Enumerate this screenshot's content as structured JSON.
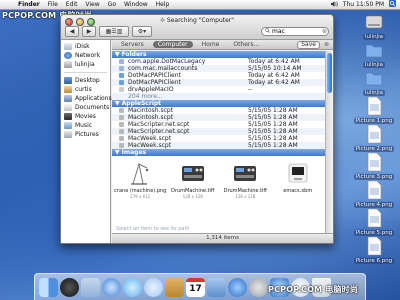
{
  "menubar": {
    "items": [
      "Finder",
      "File",
      "Edit",
      "View",
      "Go",
      "Window",
      "Help"
    ],
    "clock": "Thu 11:50 PM"
  },
  "watermarks": {
    "top_left": "PCPOP.COM 电脑时尚",
    "bottom_right": "PCPOP.COM 电脑时尚"
  },
  "window": {
    "title": "Searching \"Computer\"",
    "search_value": "mac",
    "search_placeholder": "Search",
    "scopes": [
      "Servers",
      "Computer",
      "Home",
      "Others..."
    ],
    "active_scope": "Computer",
    "save_label": "Save",
    "sidebar": {
      "places": [
        {
          "label": "iDisk",
          "icon": "idisk-icon"
        },
        {
          "label": "Network",
          "icon": "network-icon"
        },
        {
          "label": "lulinjia",
          "icon": "drive-icon"
        }
      ],
      "folders": [
        {
          "label": "Desktop",
          "icon": "desktop-icon"
        },
        {
          "label": "curtis",
          "icon": "home-icon"
        },
        {
          "label": "Applications",
          "icon": "applications-icon"
        },
        {
          "label": "Documents",
          "icon": "documents-icon"
        },
        {
          "label": "Movies",
          "icon": "movies-icon"
        },
        {
          "label": "Music",
          "icon": "music-icon"
        },
        {
          "label": "Pictures",
          "icon": "pictures-icon"
        }
      ]
    },
    "groups": {
      "folders": {
        "label": "Folders",
        "rows": [
          {
            "name": "com.apple.DotMacLegacy",
            "date": "Today at 6:42 AM"
          },
          {
            "name": "com.mac.mailaccounts",
            "date": "5/15/05 10:14 AM"
          },
          {
            "name": "DotMacPAPIClient",
            "date": "Today at 6:42 AM"
          },
          {
            "name": "DotMacPAPIClient",
            "date": "Today at 6:42 AM"
          },
          {
            "name": "drvAppleMacIO",
            "date": "--"
          }
        ],
        "more": "204 more..."
      },
      "applescript": {
        "label": "AppleScript",
        "rows": [
          {
            "name": "Macintosh.scpt",
            "date": "5/15/05 1:28 AM"
          },
          {
            "name": "Macintosh.scpt",
            "date": "5/15/05 1:28 AM"
          },
          {
            "name": "MacScripter.net.scpt",
            "date": "5/15/05 1:28 AM"
          },
          {
            "name": "MacScripter.net.scpt",
            "date": "5/15/05 1:28 AM"
          },
          {
            "name": "MacWeek.scpt",
            "date": "5/15/05 1:28 AM"
          },
          {
            "name": "MacWeek.scpt",
            "date": "5/15/05 1:28 AM"
          }
        ]
      },
      "images": {
        "label": "Images",
        "items": [
          {
            "name": "crane (machine).png",
            "size": "279 x 612"
          },
          {
            "name": "DrumMachine.tiff",
            "size": "128 x 128"
          },
          {
            "name": "DrumMachine.tiff",
            "size": "128 x 128"
          },
          {
            "name": "emacs.xbm",
            "size": ""
          }
        ],
        "hint": "Select an item to see its path"
      }
    },
    "status": "1,314 items"
  },
  "desktop_icons": [
    {
      "label": "lulinjia",
      "icon": "hard-drive-icon"
    },
    {
      "label": "lulinjia",
      "icon": "folder-icon"
    },
    {
      "label": "lulinjia",
      "icon": "folder-icon"
    },
    {
      "label": "Picture 1.png",
      "icon": "png-file-icon"
    },
    {
      "label": "Picture 2.png",
      "icon": "png-file-icon"
    },
    {
      "label": "Picture 3.png",
      "icon": "png-file-icon"
    },
    {
      "label": "Picture 4.png",
      "icon": "png-file-icon"
    },
    {
      "label": "Picture 5.png",
      "icon": "png-file-icon"
    },
    {
      "label": "Picture 6.png",
      "icon": "png-file-icon"
    }
  ],
  "dock_icons": [
    {
      "name": "finder-dock-icon",
      "color": "#4f8fe0"
    },
    {
      "name": "dashboard-dock-icon",
      "color": "#222222"
    },
    {
      "name": "mail-dock-icon",
      "color": "#8fb3d9"
    },
    {
      "name": "safari-dock-icon",
      "color": "#3b82d6"
    },
    {
      "name": "ichat-dock-icon",
      "color": "#59b0f0"
    },
    {
      "name": "itunes-dock-icon",
      "color": "#9fc5ee"
    },
    {
      "name": "address-book-dock-icon",
      "color": "#b8862e"
    },
    {
      "name": "ical-dock-icon",
      "color": "#d9d9d9"
    },
    {
      "name": "iphoto-dock-icon",
      "color": "#5b8fcd"
    },
    {
      "name": "quicktime-dock-icon",
      "color": "#2f6fc8"
    },
    {
      "name": "system-preferences-dock-icon",
      "color": "#9aa0a8"
    },
    {
      "name": "ie-dock-icon",
      "color": "#2f78cf"
    },
    {
      "name": "itunes-dock-icon",
      "color": "#c7d6ea"
    },
    {
      "name": "trash-dock-icon",
      "color": "#cfd6de"
    }
  ],
  "ical_day": "17"
}
